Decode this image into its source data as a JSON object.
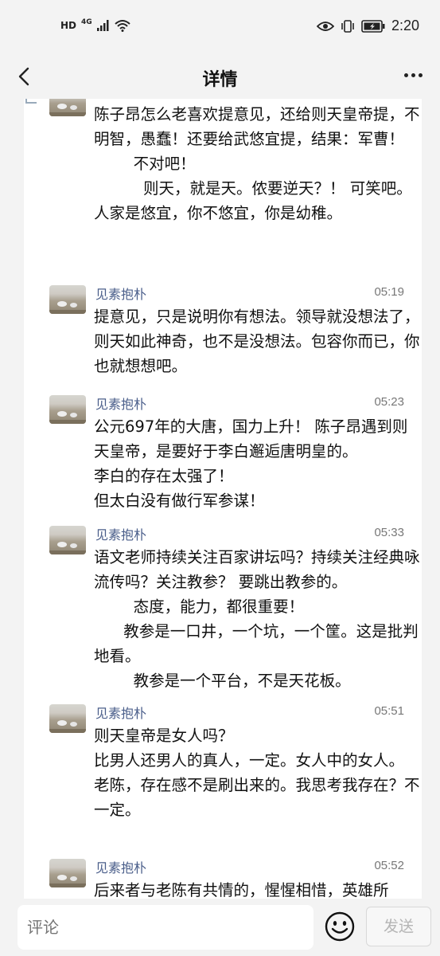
{
  "status_bar": {
    "hd": "HD",
    "network": "4G",
    "time": "2:20"
  },
  "navbar": {
    "title": "详情"
  },
  "messages": [
    {
      "name": "",
      "time": "",
      "text": "陈子昂怎么老喜欢提意见，还给则天皇帝提，不明智，愚蠢！还要给武悠宜提，结果：军曹！\n        不对吧！\n          则天，就是天。侬要逆天？！ 可笑吧。\n人家是悠宜，你不悠宜，你是幼稚。"
    },
    {
      "name": "见素抱朴",
      "time": "05:19",
      "text": "提意见，只是说明你有想法。领导就没想法了，则天如此神奇，也不是没想法。包容你而已，你也就想想吧。"
    },
    {
      "name": "见素抱朴",
      "time": "05:23",
      "text": "公元697年的大唐，国力上升！ 陈子昂遇到则天皇帝，是要好于李白邂逅唐明皇的。\n李白的存在太强了！\n但太白没有做行军参谋！"
    },
    {
      "name": "见素抱朴",
      "time": "05:33",
      "text": "语文老师持续关注百家讲坛吗？持续关注经典咏流传吗？关注教参？ 要跳出教参的。\n        态度，能力，都很重要！\n      教参是一口井，一个坑，一个筐。这是批判地看。\n        教参是一个平台，不是天花板。"
    },
    {
      "name": "见素抱朴",
      "time": "05:51",
      "text": "则天皇帝是女人吗？\n比男人还男人的真人，一定。女人中的女人。\n老陈，存在感不是刷出来的。我思考我存在？不一定。"
    },
    {
      "name": "见素抱朴",
      "time": "05:52",
      "text": "后来者与老陈有共情的，惺惺相惜，英雄所"
    }
  ],
  "bottom_bar": {
    "comment_placeholder": "评论",
    "send_label": "发送"
  },
  "icons": {
    "back": "back-arrow-icon",
    "more": "more-dots-icon",
    "emoji": "smiley-face-icon",
    "wifi": "wifi-icon",
    "signal": "signal-icon",
    "battery": "battery-icon",
    "eye": "eye-icon",
    "vibrate": "vibrate-icon"
  }
}
